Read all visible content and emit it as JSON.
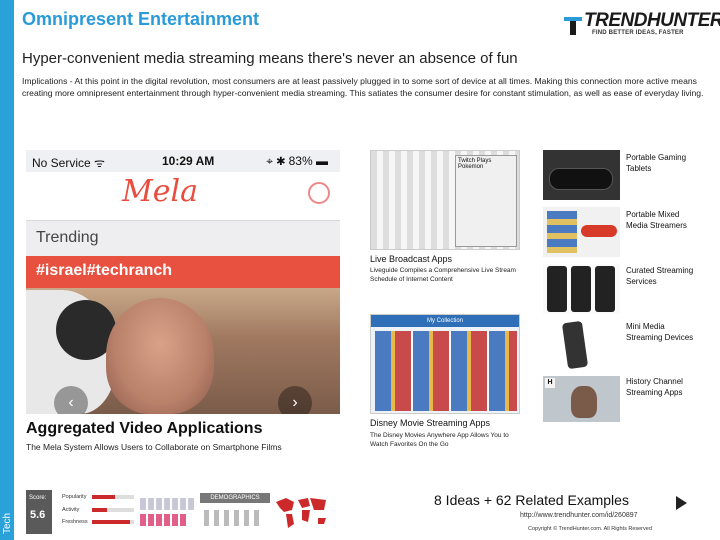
{
  "side_tab": "Tech",
  "title": "Omnipresent Entertainment",
  "brand": {
    "name": "TRENDHUNTER",
    "tagline": "FIND BETTER IDEAS, FASTER",
    "color": "#2a9bd8"
  },
  "subtitle": "Hyper-convenient media streaming means there's never an absence of fun",
  "description": "Implications - At this point in the digital revolution, most consumers are at least passively plugged in to some sort of device at all times. Making this connection more active means creating more omnipresent entertainment through hyper-convenient media streaming. This satiates the consumer desire for constant stimulation, as well as ease of everyday living.",
  "hero": {
    "status_left": "No Service ᯤ",
    "status_time": "10:29 AM",
    "status_right": "⌖ ✱ 83% ▬",
    "app_logo": "Mela",
    "trending_label": "Trending",
    "tag": "#israel#techranch",
    "prev_icon": "‹",
    "next_icon": "›"
  },
  "main_item": {
    "title": "Aggregated Video Applications",
    "subtitle": "The Mela System Allows Users to Collaborate on Smartphone Films"
  },
  "score": {
    "label": "Score:",
    "value": "5.6",
    "metrics": [
      {
        "name": "Popularity",
        "level": 0.55
      },
      {
        "name": "Activity",
        "level": 0.35
      },
      {
        "name": "Freshness",
        "level": 0.9
      }
    ],
    "demographics_label": "DEMOGRAPHICS"
  },
  "middle_items": [
    {
      "title": "Live Broadcast Apps",
      "subtitle": "Liveguide Compiles a Comprehensive Live Stream Schedule of Internet Content",
      "thumb_text": "Twitch Plays Pokemon"
    },
    {
      "title": "Disney Movie Streaming Apps",
      "subtitle": "The Disney Movies Anywhere App Allows You to Watch Favorites On the Go",
      "thumb_text": "My Collection"
    }
  ],
  "related": [
    {
      "label": "Portable Gaming Tablets"
    },
    {
      "label": "Portable Mixed Media Streamers"
    },
    {
      "label": "Curated Streaming Services"
    },
    {
      "label": "Mini Media Streaming Devices"
    },
    {
      "label": "History Channel Streaming Apps"
    }
  ],
  "footer": {
    "ideas": "8 Ideas + 62 Related Examples",
    "url": "http://www.trendhunter.com/id/260897",
    "copyright": "Copyright © TrendHunter.com. All Rights Reserved"
  }
}
